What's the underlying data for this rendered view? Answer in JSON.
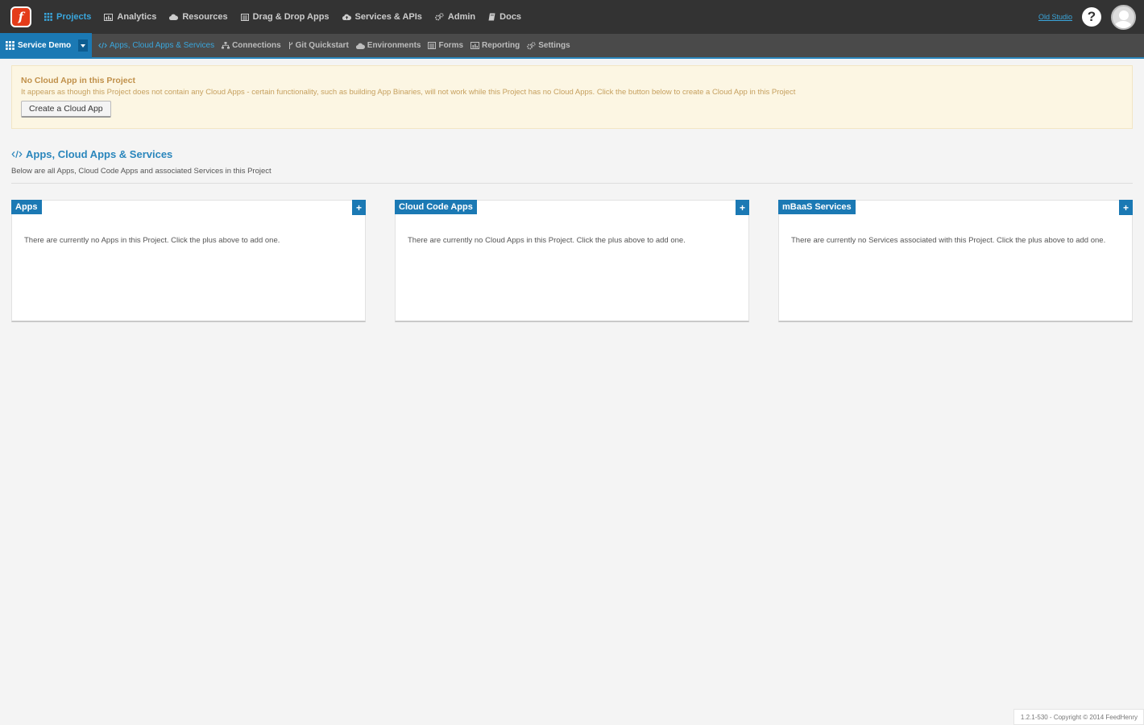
{
  "header": {
    "logo_letter": "f",
    "nav": [
      {
        "label": "Projects",
        "icon": "grid-icon",
        "active": true
      },
      {
        "label": "Analytics",
        "icon": "bar-chart-icon"
      },
      {
        "label": "Resources",
        "icon": "cloud-icon"
      },
      {
        "label": "Drag & Drop Apps",
        "icon": "list-icon"
      },
      {
        "label": "Services & APIs",
        "icon": "cloud-upload-icon"
      },
      {
        "label": "Admin",
        "icon": "cogs-icon"
      },
      {
        "label": "Docs",
        "icon": "book-icon"
      }
    ],
    "old_studio": "Old Studio",
    "help": "?"
  },
  "subbar": {
    "project_name": "Service Demo",
    "nav": [
      {
        "label": "Apps, Cloud Apps & Services",
        "icon": "code-icon",
        "active": true
      },
      {
        "label": "Connections",
        "icon": "sitemap-icon"
      },
      {
        "label": "Git Quickstart",
        "icon": "branch-icon"
      },
      {
        "label": "Environments",
        "icon": "cloud-icon"
      },
      {
        "label": "Forms",
        "icon": "list-icon"
      },
      {
        "label": "Reporting",
        "icon": "bar-chart-icon"
      },
      {
        "label": "Settings",
        "icon": "cogs-icon"
      }
    ]
  },
  "alert": {
    "title": "No Cloud App in this Project",
    "text": "It appears as though this Project does not contain any Cloud Apps - certain functionality, such as building App Binaries, will not work while this Project has no Cloud Apps. Click the button below to create a Cloud App in this Project",
    "button": "Create a Cloud App"
  },
  "section": {
    "title": "Apps, Cloud Apps & Services",
    "subtitle": "Below are all Apps, Cloud Code Apps and associated Services in this Project"
  },
  "panels": [
    {
      "label": "Apps",
      "add": "+",
      "text": "There are currently no Apps in this Project. Click the plus above to add one."
    },
    {
      "label": "Cloud Code Apps",
      "add": "+",
      "text": "There are currently no Cloud Apps in this Project. Click the plus above to add one."
    },
    {
      "label": "mBaaS Services",
      "add": "+",
      "text": "There are currently no Services associated with this Project. Click the plus above to add one."
    }
  ],
  "footer": "1.2.1-530 - Copyright © 2014 FeedHenry"
}
